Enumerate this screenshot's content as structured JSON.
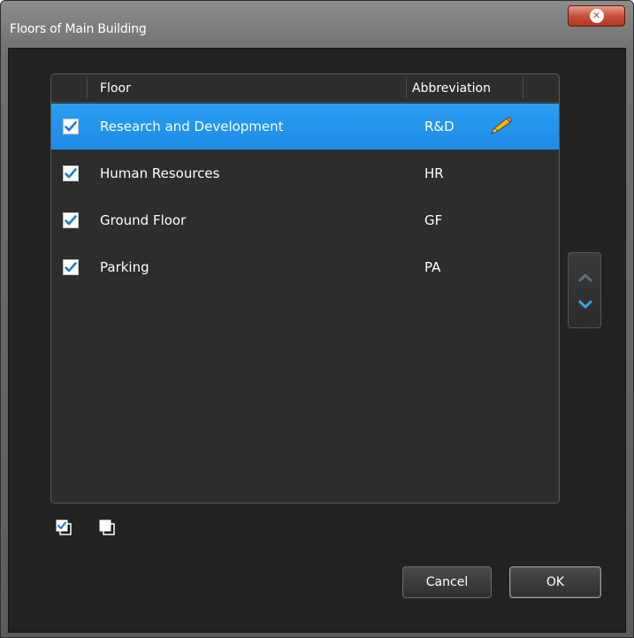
{
  "window": {
    "title": "Floors of Main Building",
    "close_icon": "close-icon"
  },
  "list": {
    "columns": [
      "Floor",
      "Abbreviation"
    ],
    "rows": [
      {
        "name": "Research and Development",
        "abbr": "R&D",
        "checked": true,
        "selected": true
      },
      {
        "name": "Human Resources",
        "abbr": "HR",
        "checked": true,
        "selected": false
      },
      {
        "name": "Ground Floor",
        "abbr": "GF",
        "checked": true,
        "selected": false
      },
      {
        "name": "Parking",
        "abbr": "PA",
        "checked": true,
        "selected": false
      }
    ],
    "edit_icon": "pencil-icon"
  },
  "reorder": {
    "up_icon": "chevron-up-icon",
    "down_icon": "chevron-down-icon"
  },
  "bulk_actions": {
    "select_all_icon": "check-all-icon",
    "deselect_all_icon": "uncheck-all-icon"
  },
  "buttons": {
    "cancel_label": "Cancel",
    "ok_label": "OK"
  },
  "colors": {
    "selection": "#1f8be8",
    "accent": "#2a9ef2",
    "close": "#c7503a",
    "background": "#222222"
  }
}
